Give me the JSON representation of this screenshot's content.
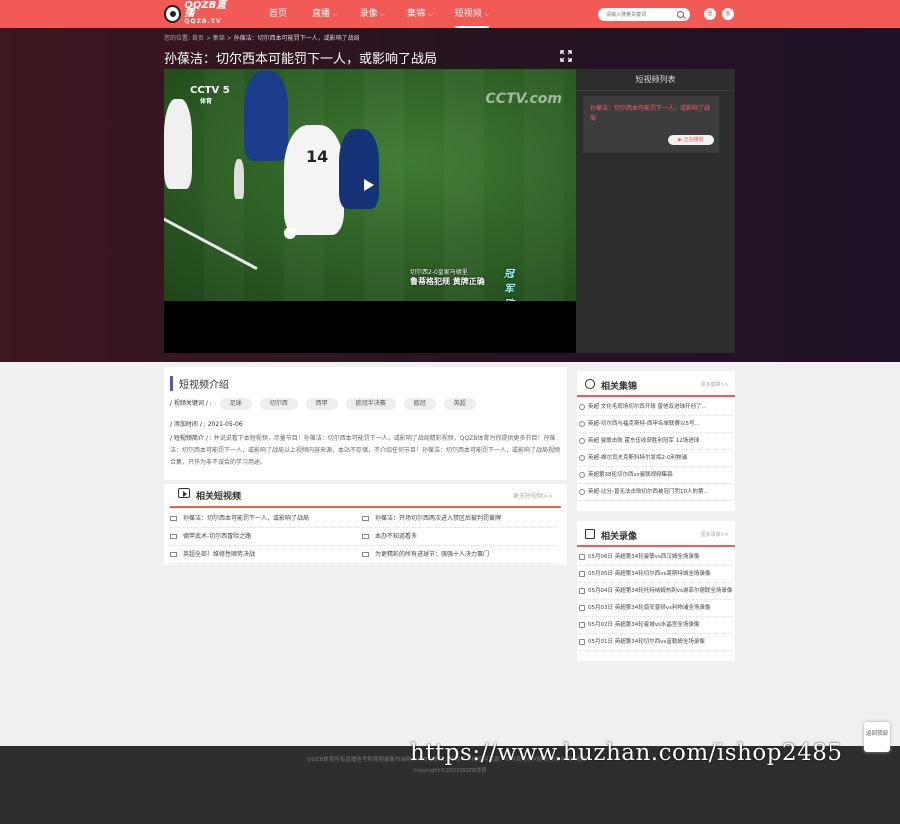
{
  "brand": {
    "logo_main": "QQZB直播",
    "logo_sub": "QQZB.TV"
  },
  "nav": [
    {
      "label": "首页",
      "chevron": false,
      "active": false
    },
    {
      "label": "直播",
      "chevron": true,
      "active": false
    },
    {
      "label": "录像",
      "chevron": true,
      "active": false
    },
    {
      "label": "集锦",
      "chevron": true,
      "active": false
    },
    {
      "label": "短视频",
      "chevron": true,
      "active": true
    }
  ],
  "search": {
    "placeholder": "请输入搜索关键词"
  },
  "header_buttons": [
    "登",
    "客"
  ],
  "breadcrumb": {
    "prefix": "您的位置: 首页 > 集锦 > ",
    "current": "孙葆洁：切尔西本可能罚下一人，或影响了战局"
  },
  "page_title": "孙葆洁：切尔西本可能罚下一人，或影响了战局",
  "video": {
    "channel": "CCTV 5",
    "channel_sub": "体育",
    "watermark": "CCTV.com",
    "caption_top": "切尔西2-0皇家马德里",
    "caption_main": "鲁蒂格犯规 黄牌正确",
    "caption_tag": "冠军欧洲"
  },
  "side_list": {
    "title": "短视频列表",
    "card_text": "孙葆洁：切尔西本可能罚下一人，或影响了战局",
    "card_button": "▶ 正在播放"
  },
  "intro": {
    "title": "短视频介绍",
    "keywords_label": "/ 视频关键词 / :",
    "keywords": [
      "足球",
      "切尔西",
      "西甲",
      "欧冠半决赛",
      "欧冠",
      "英超"
    ],
    "date_label": "/ 添加时间 / :",
    "date": "2021-05-06",
    "summary_label": "/ 短视频简介 / :",
    "summary": "并说说看下本短视频，尽量节目！孙葆洁：切尔西本可能罚下一人，或影响了战局精彩视频，QQZB体育为你提供更多节目！孙葆洁：切尔西本可能罚下一人，或影响了战局以上视频内容来源，本站不存储，不介绍任何节目！孙葆洁：切尔西本可能罚下一人，或影响了战局视频合集，只作为非不误会的学习用途。"
  },
  "related_shorts": {
    "title": "相关短视频",
    "more": "更多短视频>>",
    "items": [
      "孙葆洁：切尔西本可能罚下一人，或影响了战局",
      "孙葆洁：开场切尔西两次进入禁区后被判罚黄牌",
      "德甲武术-切尔西冒险之路",
      "本办不知道看多",
      "英超全部！维修性顺势决战",
      "为更精彩的所有进球节：强强十人决力事门"
    ]
  },
  "related_highlights": {
    "title": "相关集锦",
    "more": "更多集锦>>",
    "items": [
      "英超 文化毛现场切尔西开球 曾他双进球开创了...",
      "英超-切尔西与福克斯特-西甲名单联赛以5号...",
      "英超 曼联击败 霍东伍收获胜利冠军 12场进球",
      "英超-维尔贡夫克斯科特尔发挥2-0利物浦",
      "英超第38轮切尔西vs曼联视频集锦",
      "英超-比分-曾无法击败切尔西被冠门罚10人的第..."
    ]
  },
  "related_replays": {
    "title": "相关录像",
    "more": "更多录像>>",
    "items": [
      "05月06日 英超第34轮曼联vs西汉姆全场录像",
      "05月05日 英超第34轮切尔西vs莱斯特城全场录像",
      "05月04日 英超第34轮托特纳姆热刺vs谢菲尔德联全场录像",
      "05月03日 英超第34轮南安普顿vs利物浦全场录像",
      "05月02日 英超第34轮曼城vs水晶宫全场录像",
      "05月01日 英超第34轮切尔西vs富勒姆全场录像"
    ]
  },
  "footer": {
    "line1": "QQZB体育所有直播信号和视频录像均由网友来自互联网，本站不存储任何资源，如涉及版权问题请及时与我们联系！",
    "line2": "Copyright©2021QQZB体育"
  },
  "overlay_url": "https://www.huzhan.com/ishop2485",
  "back_top": "返回顶部",
  "colors": {
    "accent": "#f25a55",
    "hero_bg": "#281421",
    "side_bg": "#2d2d2d"
  }
}
